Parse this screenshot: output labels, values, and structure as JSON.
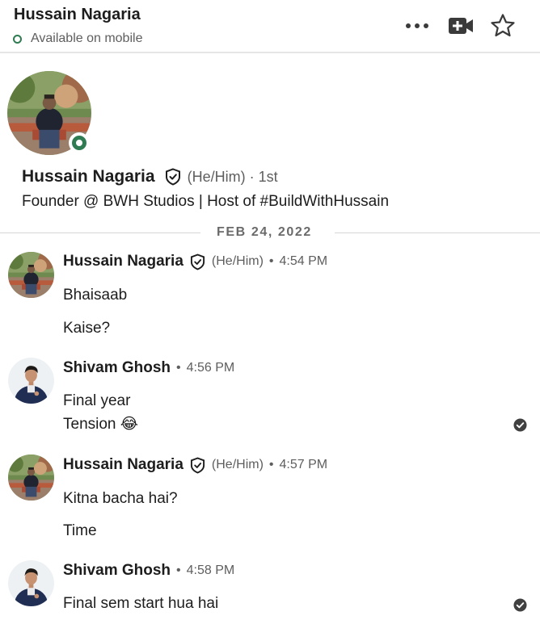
{
  "header": {
    "name": "Hussain Nagaria",
    "status": "Available on mobile"
  },
  "profile": {
    "name": "Hussain Nagaria",
    "pronouns": "(He/Him)",
    "separator": "·",
    "degree": "1st",
    "headline": "Founder @ BWH Studios | Host of #BuildWithHussain"
  },
  "date_divider": "FEB 24, 2022",
  "messages": [
    {
      "sender": "Hussain Nagaria",
      "pronouns": "(He/Him)",
      "time": "4:54 PM",
      "lines": [
        "Bhaisaab",
        "Kaise?"
      ]
    },
    {
      "sender": "Shivam Ghosh",
      "time": "4:56 PM",
      "lines": [
        "Final year",
        "Tension 😂"
      ],
      "read": true
    },
    {
      "sender": "Hussain Nagaria",
      "pronouns": "(He/Him)",
      "time": "4:57 PM",
      "lines": [
        "Kitna bacha hai?",
        "Time"
      ]
    },
    {
      "sender": "Shivam Ghosh",
      "time": "4:58 PM",
      "lines": [
        "Final sem start hua hai"
      ],
      "read": true
    }
  ],
  "dot": "•",
  "colors": {
    "presence_green": "#2f7c53",
    "text_primary": "#1d1d1d",
    "text_secondary": "#5e5e5e"
  },
  "icons": {
    "more": "more-options-icon",
    "video": "video-call-icon",
    "star": "star-icon",
    "verified": "verified-shield-icon",
    "read_receipt": "read-receipt-icon"
  }
}
